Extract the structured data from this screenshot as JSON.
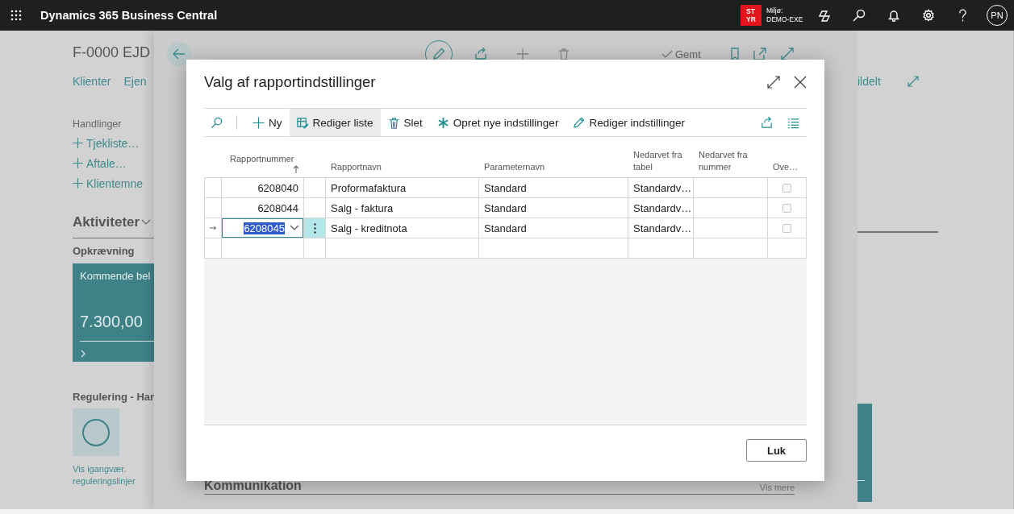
{
  "top_bar": {
    "app_name": "Dynamics 365 Business Central",
    "environment_badge": [
      "ST",
      "YR"
    ],
    "environment_label": "Miljø:",
    "environment_name": "DEMO-EXE",
    "user_initials": "PN"
  },
  "base_page": {
    "title": "F-0000 EJD",
    "nav": [
      "Klienter",
      "Ejen"
    ],
    "nav_right": "ildelt",
    "actions_heading": "Handlinger",
    "actions": [
      "Tjekliste…",
      "Aftale…",
      "Klientemne"
    ],
    "section_title": "Aktiviteter",
    "group_title": "Opkrævning",
    "tile": {
      "label": "Kommende bel",
      "value": "7.300,00"
    },
    "group2_title": "Regulering - Han",
    "link_tile": {
      "label": "Vis igangvær. reguleringslinjer"
    }
  },
  "card_page": {
    "save_status": "Gemt",
    "section_title": "Kommunikation",
    "section_link": "Vis mere"
  },
  "dialog": {
    "title": "Valg af rapportindstillinger",
    "toolbar": [
      {
        "label": "Ny",
        "selected": false
      },
      {
        "label": "Rediger liste",
        "selected": true
      },
      {
        "label": "Slet",
        "selected": false
      },
      {
        "label": "Opret nye indstillinger",
        "selected": false
      },
      {
        "label": "Rediger indstillinger",
        "selected": false
      }
    ],
    "table": {
      "columns": [
        {
          "label": "Rapportnummer",
          "sorted": true
        },
        {
          "label": "Rapportnavn",
          "sorted": false
        },
        {
          "label": "Parameternavn",
          "sorted": false
        },
        {
          "label": "Nedarvet fra tabel",
          "sorted": false
        },
        {
          "label": "Nedarvet fra nummer",
          "sorted": false
        },
        {
          "label": "Ove…",
          "sorted": false
        }
      ],
      "rows": [
        {
          "kind": "record",
          "selected": false,
          "number": "6208040",
          "name": "Proformafaktura",
          "parameter": "Standard",
          "inherited_table": "Standardv…",
          "override": false
        },
        {
          "kind": "record",
          "selected": false,
          "number": "6208044",
          "name": "Salg - faktura",
          "parameter": "Standard",
          "inherited_table": "Standardv…",
          "override": false
        },
        {
          "kind": "record",
          "selected": true,
          "number": "6208045",
          "name": "Salg - kreditnota",
          "parameter": "Standard",
          "inherited_table": "Standardv…",
          "override": false
        },
        {
          "kind": "new",
          "selected": false
        }
      ]
    },
    "buttons": [
      "Luk"
    ]
  }
}
